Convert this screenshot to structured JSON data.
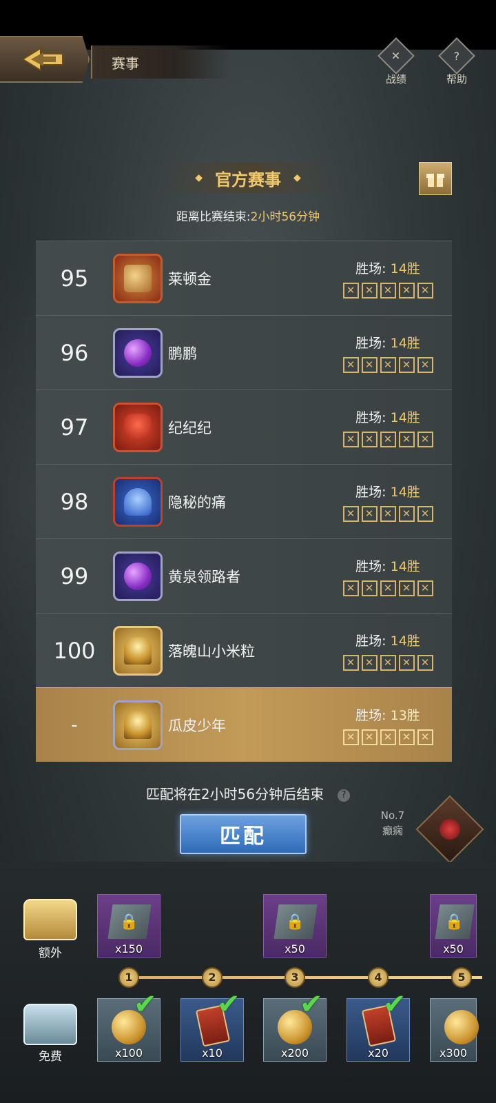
{
  "header": {
    "title": "赛事",
    "record_label": "战绩",
    "help_label": "帮助"
  },
  "event": {
    "title": "官方赛事",
    "countdown_prefix": "距离比赛结束:",
    "countdown_time": "2小时56分钟"
  },
  "ranking": {
    "wins_label": "胜场:",
    "rows": [
      {
        "rank": "95",
        "name": "莱顿金",
        "wins": "14胜",
        "avatar": "win-trophy-avatar"
      },
      {
        "rank": "96",
        "name": "鹏鹏",
        "wins": "14胜",
        "avatar": "purple-orb-avatar"
      },
      {
        "rank": "97",
        "name": "纪纪纪",
        "wins": "14胜",
        "avatar": "red-mask-avatar"
      },
      {
        "rank": "98",
        "name": "隐秘的痛",
        "wins": "14胜",
        "avatar": "blue-crest-avatar"
      },
      {
        "rank": "99",
        "name": "黄泉领路者",
        "wins": "14胜",
        "avatar": "purple-orb-avatar"
      },
      {
        "rank": "100",
        "name": "落魄山小米粒",
        "wins": "14胜",
        "avatar": "golden-helmet-avatar"
      }
    ],
    "me": {
      "rank": "-",
      "name": "瓜皮少年",
      "wins": "13胜",
      "avatar": "golden-helmet-avatar"
    }
  },
  "match": {
    "info": "匹配将在2小时56分钟后结束",
    "button_label": "匹配",
    "help_icon": "?"
  },
  "season": {
    "no": "No.7",
    "name": "癫痫"
  },
  "rewards": {
    "extra_label": "额外",
    "free_label": "免费",
    "extra": [
      {
        "amount": "x150",
        "locked": true
      },
      {
        "amount": "x50",
        "locked": true
      },
      {
        "amount": "x50",
        "locked": true
      }
    ],
    "nodes": [
      "1",
      "2",
      "3",
      "4",
      "5"
    ],
    "free": [
      {
        "amount": "x100",
        "type": "coin",
        "claimed": true
      },
      {
        "amount": "x10",
        "type": "card",
        "claimed": true
      },
      {
        "amount": "x200",
        "type": "coin",
        "claimed": true
      },
      {
        "amount": "x20",
        "type": "card",
        "claimed": true
      },
      {
        "amount": "x300",
        "type": "coin",
        "claimed": true
      }
    ]
  },
  "colors": {
    "accent_gold": "#f1c96a",
    "match_blue": "#2f6ab8",
    "me_row": "#c39a57"
  }
}
